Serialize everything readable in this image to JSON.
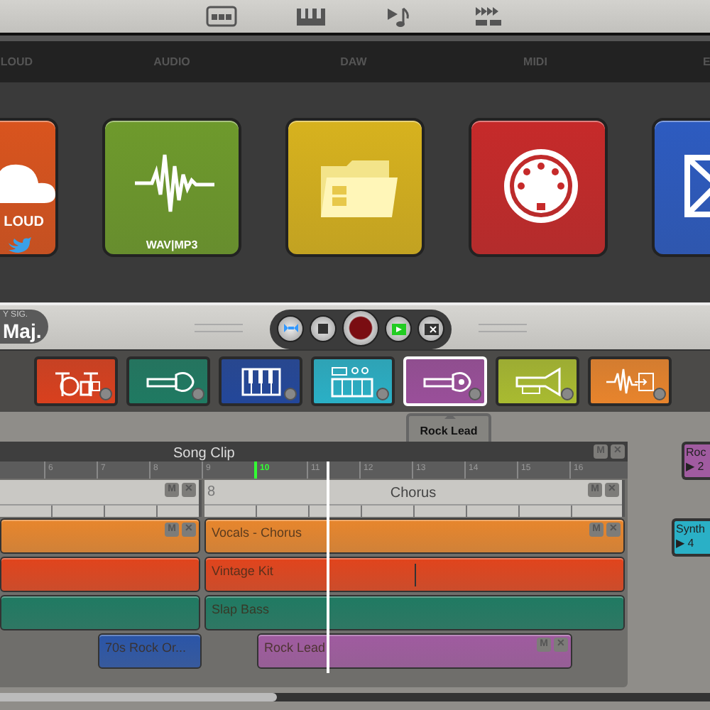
{
  "categories": [
    {
      "label": "LOUD"
    },
    {
      "label": "AUDIO"
    },
    {
      "label": "DAW"
    },
    {
      "label": "MIDI"
    },
    {
      "label": "E"
    }
  ],
  "sources": [
    {
      "kind": "cloud",
      "color": "#d9541e",
      "label": "LOUD"
    },
    {
      "kind": "audio",
      "color": "#6e9a2c",
      "label": "WAV|MP3"
    },
    {
      "kind": "folder",
      "color": "#d7b21e"
    },
    {
      "kind": "midi",
      "color": "#c62a2a"
    },
    {
      "kind": "mail",
      "color": "#2d5bc0"
    }
  ],
  "key": {
    "caption": "Y SIG.",
    "value": "Maj."
  },
  "transport": [
    {
      "kind": "loop"
    },
    {
      "kind": "stop"
    },
    {
      "kind": "record"
    },
    {
      "kind": "play"
    },
    {
      "kind": "clear"
    }
  ],
  "instruments": [
    {
      "kind": "drums",
      "color": "#d9401e",
      "selected": false
    },
    {
      "kind": "bass",
      "color": "#1f7a62",
      "selected": false
    },
    {
      "kind": "piano",
      "color": "#23479a",
      "selected": false
    },
    {
      "kind": "synth",
      "color": "#2ab0c6",
      "selected": false
    },
    {
      "kind": "guitar",
      "color": "#9a4f9a",
      "selected": true
    },
    {
      "kind": "horn",
      "color": "#a9bb30",
      "selected": false
    },
    {
      "kind": "audio",
      "color": "#e8842c",
      "selected": false
    }
  ],
  "tooltip": "Rock Lead",
  "song_clip": {
    "title": "Song Clip",
    "buttons": [
      "M",
      "✕"
    ],
    "ruler": [
      {
        "label": "6",
        "current": false
      },
      {
        "label": "7",
        "current": false
      },
      {
        "label": "8",
        "current": false
      },
      {
        "label": "9",
        "current": false
      },
      {
        "label": "10",
        "current": true
      },
      {
        "label": "11",
        "current": false
      },
      {
        "label": "12",
        "current": false
      },
      {
        "label": "13",
        "current": false
      },
      {
        "label": "14",
        "current": false
      },
      {
        "label": "15",
        "current": false
      },
      {
        "label": "16",
        "current": false
      }
    ],
    "sections": [
      {
        "buttons": [
          "M",
          "✕"
        ]
      },
      {
        "number": "8",
        "name": "Chorus",
        "buttons": [
          "M",
          "✕"
        ]
      }
    ],
    "tracks": [
      {
        "clips": [
          {
            "color": "#e8862c",
            "buttons": [
              "M",
              "✕"
            ]
          },
          {
            "color": "#e8862c",
            "name": "Vocals - Chorus",
            "buttons": [
              "M",
              "✕"
            ]
          }
        ]
      },
      {
        "clips": [
          {
            "color": "#e2441c"
          },
          {
            "color": "#e2441c",
            "name": "Vintage Kit"
          }
        ]
      },
      {
        "clips": [
          {
            "color": "#1f7a62"
          },
          {
            "color": "#1f7a62",
            "name": "Slap Bass"
          }
        ]
      },
      {
        "clips": [
          {
            "color": "#2a55a8",
            "name": "70s Rock Or..."
          },
          {
            "color": "#a05ba0",
            "name": "Rock Lead",
            "buttons": [
              "M",
              "✕"
            ]
          }
        ]
      }
    ]
  },
  "side_clips": [
    {
      "name": "Roc",
      "detail": "▶ 2",
      "color": "#a05ba0"
    },
    {
      "name": "Synth",
      "detail": "▶ 4",
      "color": "#2ab0c6"
    }
  ]
}
